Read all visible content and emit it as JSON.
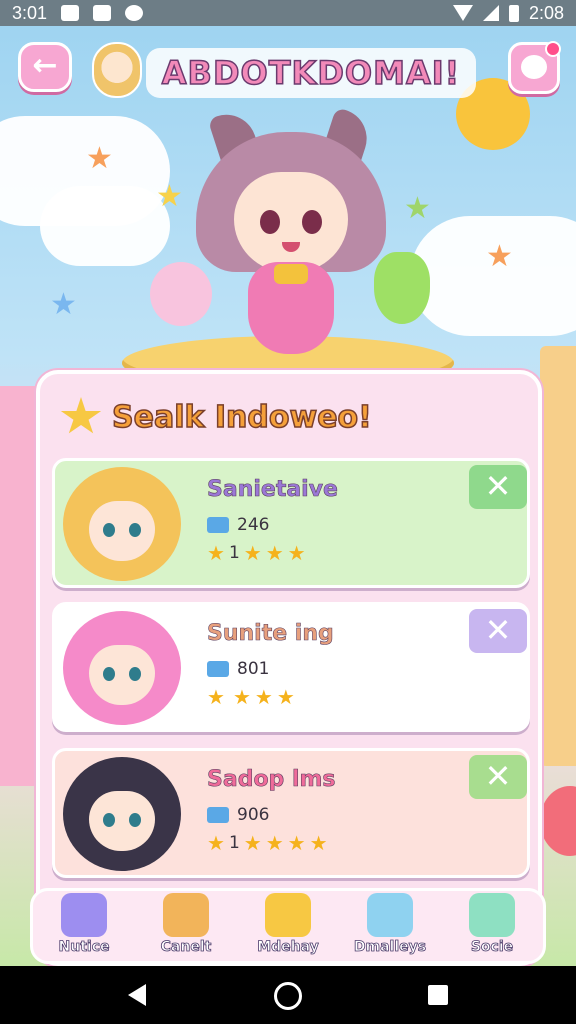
{
  "status_bar": {
    "time_left": "3:01",
    "time_right": "2:08",
    "left_icons": [
      "camera-icon",
      "photo-icon",
      "game-icon"
    ],
    "right_icons": [
      "wifi-icon",
      "signal-icon",
      "battery-icon"
    ]
  },
  "header": {
    "title": "ABDOTKDOMAI!",
    "back_icon": "←"
  },
  "panel": {
    "title": "Sealk Indoweo!",
    "characters": [
      {
        "name": "Sanietaive",
        "stat": "246",
        "rating_text": "1",
        "stars": 3,
        "name_color": "#9b78d6",
        "card_color": "#d8f3c9",
        "button_color": "#8fd98c",
        "portrait_color": "#f4c35a"
      },
      {
        "name": "Sunite ing",
        "stat": "801",
        "rating_text": "",
        "stars": 3,
        "name_color": "#e8a07d",
        "card_color": "#ffffff",
        "button_color": "#c8b6f0",
        "portrait_color": "#f58ac9"
      },
      {
        "name": "Sadop lms",
        "stat": "906",
        "rating_text": "1",
        "stars": 4,
        "name_color": "#ef6b9a",
        "card_color": "#fde1dc",
        "button_color": "#a8dd8f",
        "portrait_color": "#3a3448"
      }
    ],
    "remove_label": "✕"
  },
  "bottom_nav": [
    {
      "label": "Nutice",
      "icon": "box-icon",
      "color": "#9d8ef0"
    },
    {
      "label": "Canelt",
      "icon": "character-icon",
      "color": "#f2b45a"
    },
    {
      "label": "Mdehay",
      "icon": "cheese-icon",
      "color": "#f7c843"
    },
    {
      "label": "Dmalleys",
      "icon": "map-icon",
      "color": "#8fd2f0"
    },
    {
      "label": "Socie",
      "icon": "friend-icon",
      "color": "#8ee0c2"
    }
  ]
}
